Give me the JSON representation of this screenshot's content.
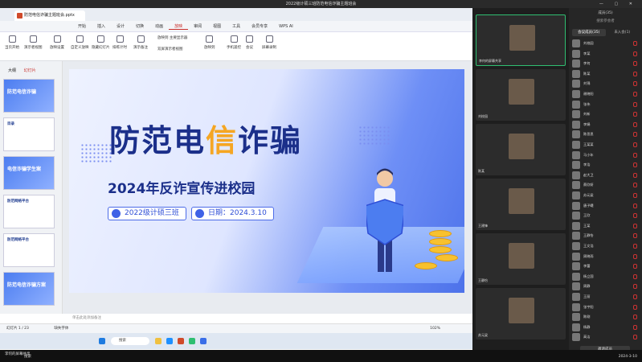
{
  "window": {
    "title": "2022级计硕三班防范电信诈骗主题班会"
  },
  "ppt": {
    "file_tab": "防范电信诈骗主题班会.pptx",
    "menu": [
      "开始",
      "插入",
      "设计",
      "切换",
      "动画",
      "放映",
      "审阅",
      "视图",
      "工具",
      "会员专享",
      "WPS AI"
    ],
    "menu_active": "放映",
    "ribbon": [
      "当页开始",
      "演示者视图",
      "放映设置",
      "自定义放映",
      "隐藏幻灯片",
      "排练计时",
      "演示备注",
      "放映到",
      "手机遥控",
      "会议",
      "屏幕录制"
    ],
    "ribbon_mid": [
      "放映到 主要显示器",
      "双屏演示者视图"
    ],
    "side_tabs": [
      "大纲",
      "幻灯片"
    ],
    "thumb_titles": [
      "防范电信诈骗",
      "目录",
      "电信诈骗学生案",
      "防范网络平台",
      "防范网络平台",
      "防范电信诈骗方案"
    ],
    "notes_placeholder": "单击此处添加备注",
    "status_left": "幻灯片 1 / 23",
    "status_font": "缺失字体",
    "zoom": "102%",
    "taskbar_search": "搜索"
  },
  "slide": {
    "title_part1": "防范电",
    "title_orange": "信",
    "title_part2": "诈骗",
    "subtitle": "2024年反诈宣传进校园",
    "class_pill": "2022级计硕三班",
    "date_pill": "日期：2024.3.10"
  },
  "videos": [
    {
      "name": "李何的屏幕共享"
    },
    {
      "name": "刘校园"
    },
    {
      "name": "陈某"
    },
    {
      "name": "王建锋"
    },
    {
      "name": "王静怡"
    },
    {
      "name": "苏元梁"
    }
  ],
  "members": {
    "header": "成员(35)",
    "search": "搜索参会者",
    "tabs": [
      "会议成员(35)",
      "未入会(1)"
    ],
    "list": [
      "刘校园",
      "李某",
      "李何",
      "陈某",
      "刘锦",
      "谢晓阳",
      "张伟",
      "刘新",
      "李娟",
      "陈思思",
      "王某某",
      "马小年",
      "李浩",
      "赵大卫",
      "蔡欣妍",
      "苏元梁",
      "唐子曦",
      "王欣",
      "王某",
      "王静怡",
      "王文浩",
      "周晓雨",
      "李蕾",
      "杨立国",
      "周静",
      "王丽",
      "张宇阳",
      "陈刚",
      "杨静",
      "高洁"
    ],
    "bottom_button": "邀请成员"
  },
  "bottom": {
    "share": "李何的屏幕共享",
    "search": "搜索",
    "time": "2024-3-10"
  }
}
